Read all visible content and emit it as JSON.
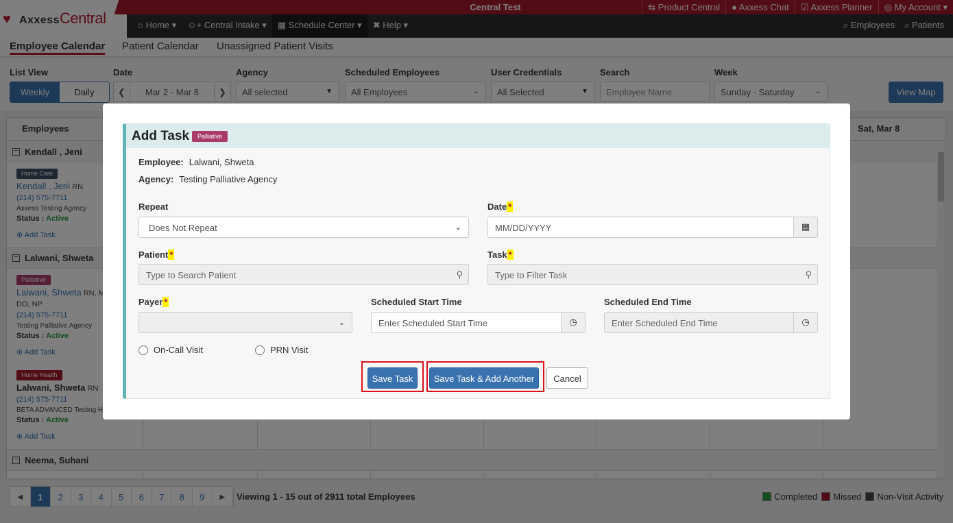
{
  "logo": {
    "mark": "♥",
    "brand": "Axxess",
    "brand2": "Central"
  },
  "env_label": "Central Test",
  "top_links": [
    "⇆ Product Central",
    "● Axxess Chat",
    "☑ Axxess Planner",
    "◎ My Account ▾"
  ],
  "nav": [
    "⌂ Home ▾",
    "☺+ Central Intake ▾",
    "▦ Schedule Center ▾",
    "✖ Help ▾"
  ],
  "nav_right": [
    "⌕ Employees",
    "⌕ Patients"
  ],
  "subtabs": [
    "Employee Calendar",
    "Patient Calendar",
    "Unassigned Patient Visits"
  ],
  "filters": {
    "list_view_label": "List View",
    "weekly": "Weekly",
    "daily": "Daily",
    "date_label": "Date",
    "date_value": "Mar 2 - Mar 8",
    "agency_label": "Agency",
    "agency_value": "All selected",
    "sched_label": "Scheduled Employees",
    "sched_value": "All Employees",
    "cred_label": "User Credentials",
    "cred_value": "All Selected",
    "search_label": "Search",
    "search_placeholder": "Employee Name",
    "week_label": "Week",
    "week_value": "Sunday - Saturday",
    "view_map": "View Map"
  },
  "calendar": {
    "employees_header": "Employees",
    "last_day_header": "Sat, Mar 8",
    "groups": [
      "Kendall , Jeni",
      "Lalwani, Shweta",
      "Neema, Suhani"
    ],
    "entries": [
      {
        "badge": "Home Care",
        "name": "Kendall , Jeni",
        "cred": "RN",
        "extra": "",
        "phone": "(214) 575-7711",
        "agency": "Axxess Testing Agency",
        "status_label": "Status : ",
        "status": "Active",
        "add": "⊕ Add Task"
      },
      {
        "badge": "Palliative",
        "name": "Lalwani, Shweta",
        "cred": "RN, MI",
        "extra": "DO, NP",
        "phone": "(214) 575-7711",
        "agency": "Testing Palliative Agency",
        "status_label": "Status : ",
        "status": "Active",
        "add": "⊕ Add Task"
      },
      {
        "badge": "Home Health",
        "name": "Lalwani, Shweta",
        "cred": "RN",
        "extra": "",
        "phone": "(214) 575-7711",
        "agency": "BETA ADVANCED Testing H",
        "status_label": "Status : ",
        "status": "Active",
        "add": "⊕ Add Task"
      }
    ]
  },
  "pager": {
    "pages": [
      "1",
      "2",
      "3",
      "4",
      "5",
      "6",
      "7",
      "8",
      "9"
    ],
    "prev": "◀",
    "next": "▶",
    "viewing": "Viewing 1 - 15 out of 2911 total Employees"
  },
  "legend": [
    {
      "label": "Completed",
      "color": "#2f9a43"
    },
    {
      "label": "Missed",
      "color": "#a5182a"
    },
    {
      "label": "Non-Visit Activity",
      "color": "#444444"
    }
  ],
  "modal": {
    "title": "Add Task",
    "badge": "Palliative",
    "employee_label": "Employee:",
    "employee_value": "Lalwani, Shweta",
    "agency_label": "Agency:",
    "agency_value": "Testing Palliative Agency",
    "repeat_label": "Repeat",
    "repeat_value": "Does Not Repeat",
    "date_label": "Date",
    "date_placeholder": "MM/DD/YYYY",
    "patient_label": "Patient",
    "patient_placeholder": "Type to Search Patient",
    "task_label": "Task",
    "task_placeholder": "Type to Filter Task",
    "payer_label": "Payer",
    "payer_value": "",
    "start_label": "Scheduled Start Time",
    "start_placeholder": "Enter Scheduled Start Time",
    "end_label": "Scheduled End Time",
    "end_placeholder": "Enter Scheduled End Time",
    "oncall_label": "On-Call Visit",
    "prn_label": "PRN Visit",
    "required_mark": "*",
    "save_task": "Save Task",
    "save_add_another": "Save Task & Add Another",
    "cancel": "Cancel"
  },
  "colors": {
    "brand_red": "#a5182a",
    "primary_blue": "#3a72b0",
    "panel_accent": "#5fb3b3",
    "highlight": "#e0111c"
  }
}
